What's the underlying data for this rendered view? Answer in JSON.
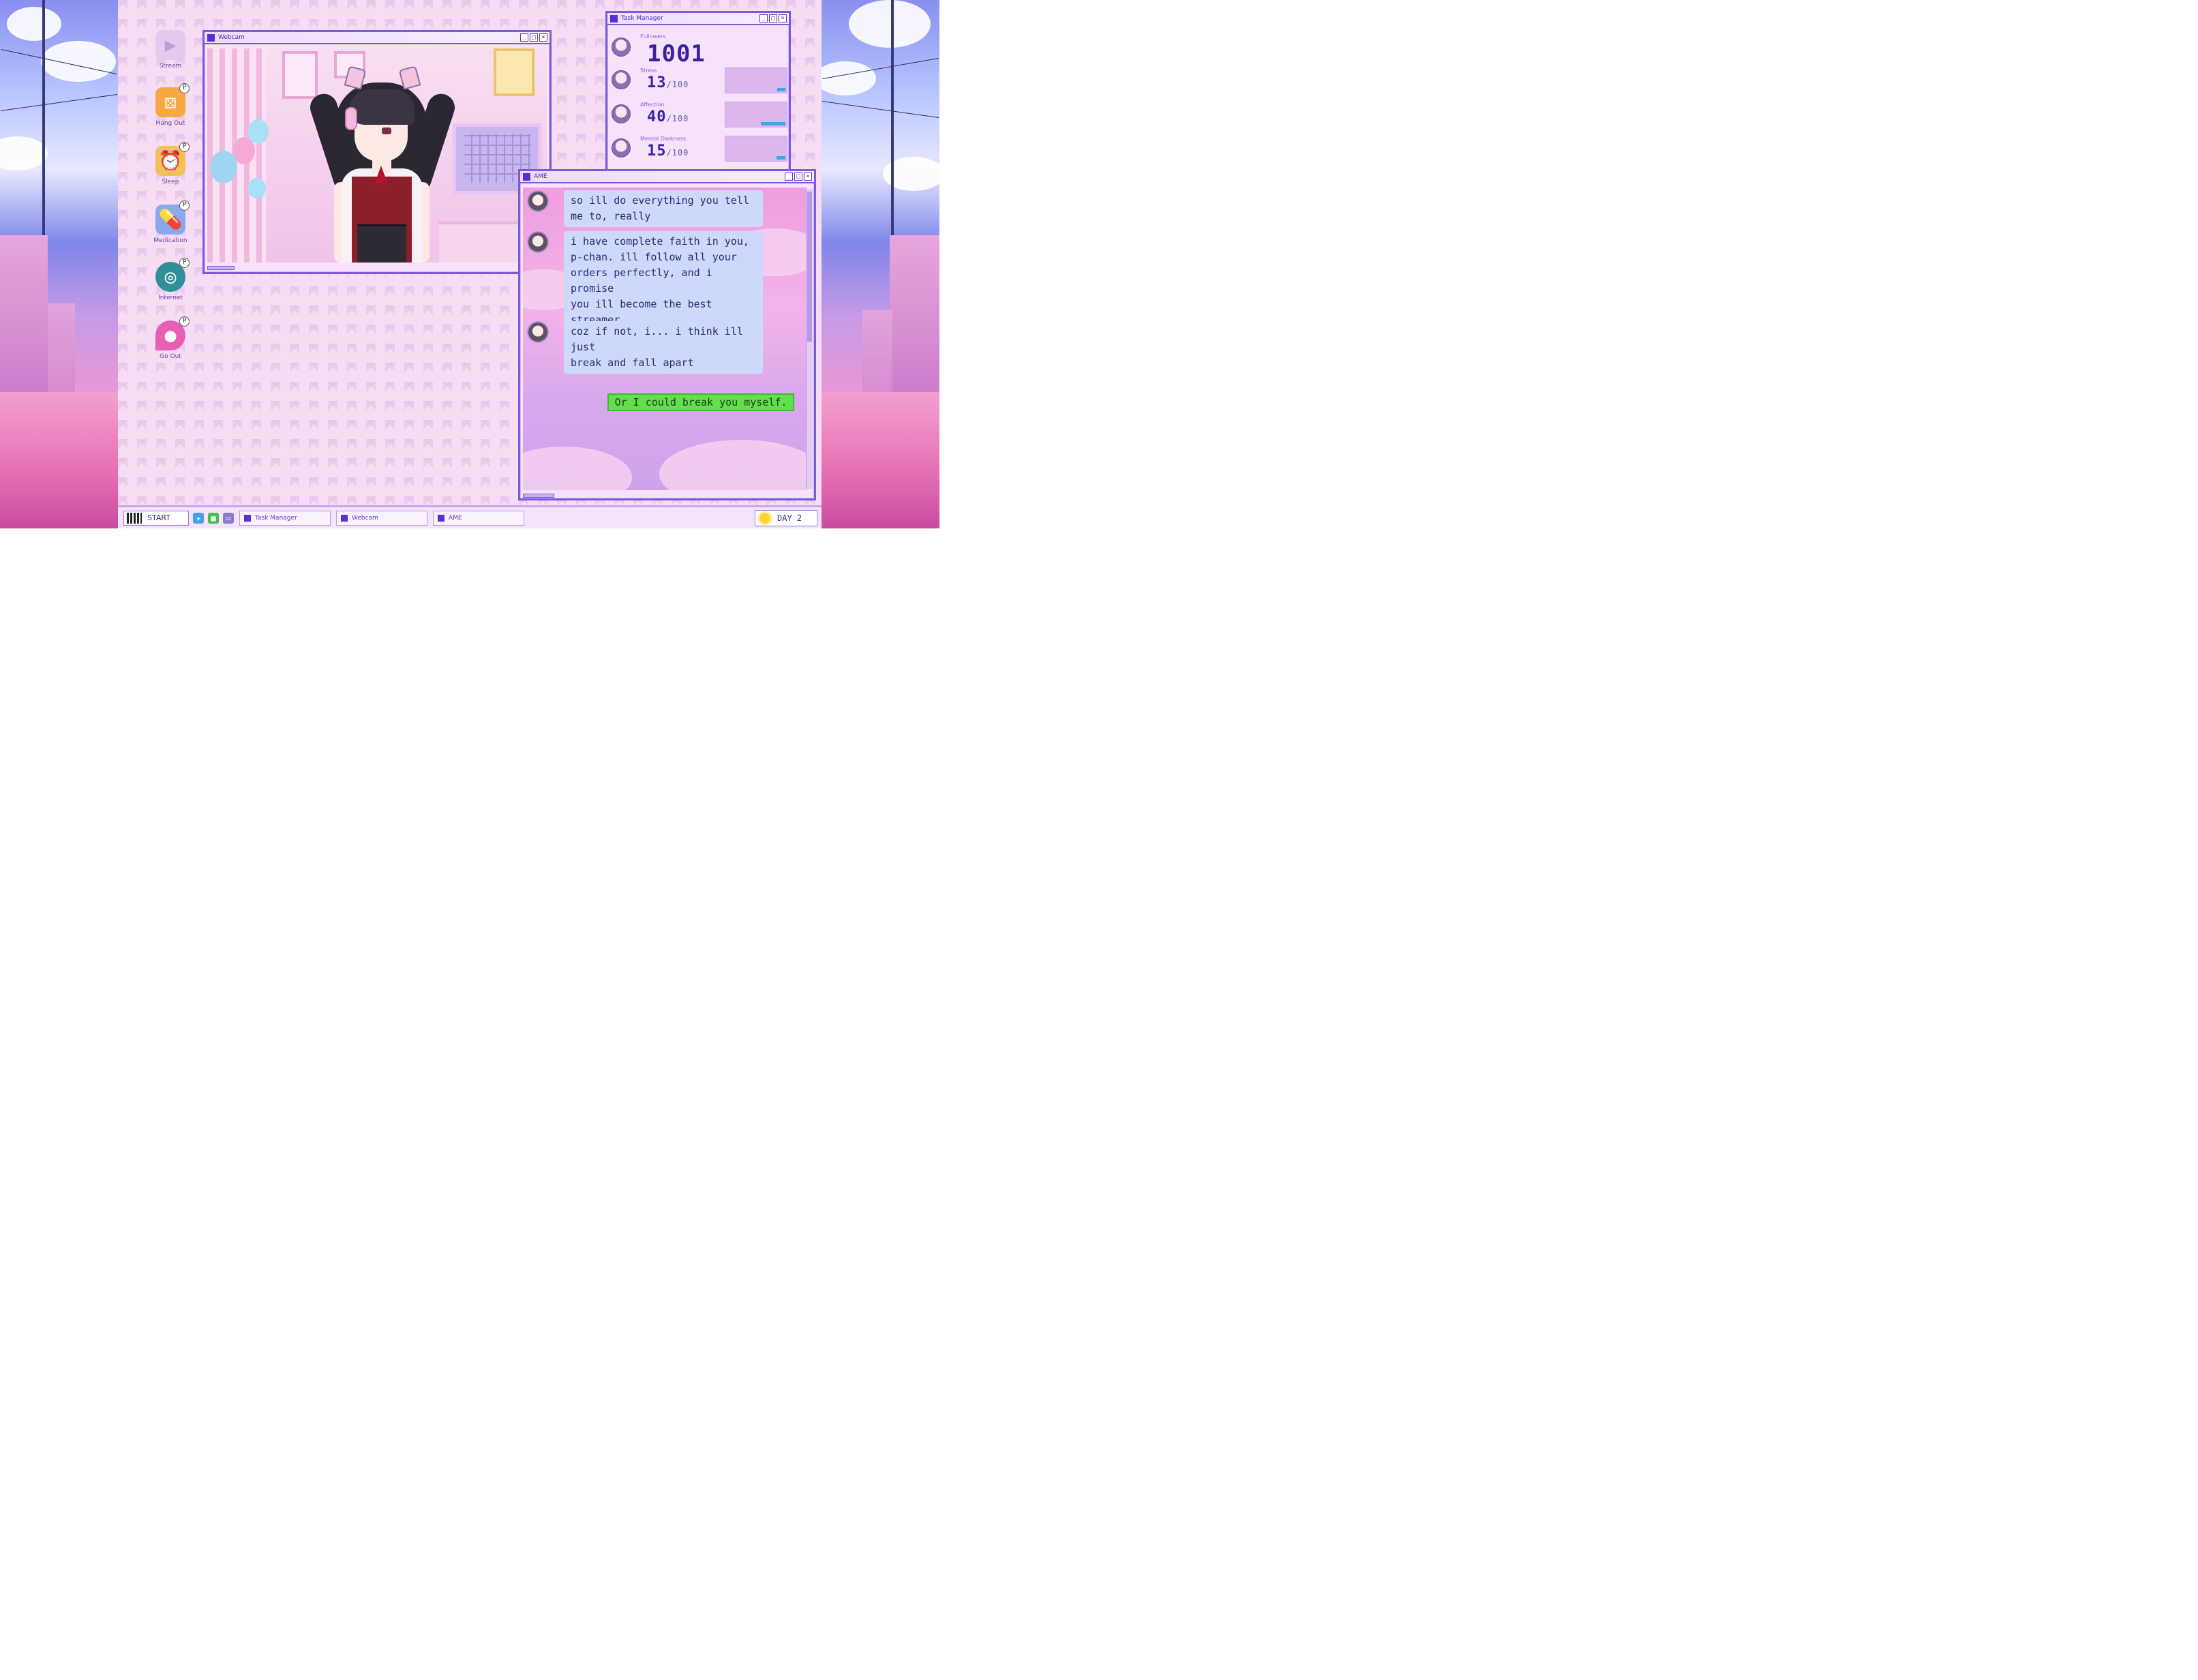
{
  "desktop_icons": [
    {
      "label": "Stream",
      "icon": "play-icon"
    },
    {
      "label": "Hang Out",
      "icon": "dice-icon"
    },
    {
      "label": "Sleep",
      "icon": "alarm-clock-icon"
    },
    {
      "label": "Medication",
      "icon": "pill-icon"
    },
    {
      "label": "Internet",
      "icon": "globe-search-icon"
    },
    {
      "label": "Go Out",
      "icon": "map-pin-icon"
    }
  ],
  "webcam": {
    "title": "Webcam"
  },
  "task_manager": {
    "title": "Task Manager",
    "stats": [
      {
        "label": "Followers",
        "value": "1001",
        "max": ""
      },
      {
        "label": "Stress",
        "value": "13",
        "max": "/100",
        "level": 0.13
      },
      {
        "label": "Affection",
        "value": "40",
        "max": "/100",
        "level": 0.4
      },
      {
        "label": "Mental Darkness",
        "value": "15",
        "max": "/100",
        "level": 0.15
      }
    ]
  },
  "chat": {
    "title": "AME",
    "messages": [
      "so ill do everything you tell\nme to, really",
      "i have complete faith in you,\np-chan. ill follow all your\norders perfectly, and i promise\nyou ill become the best\nstreamer...",
      "coz if not, i... i think ill just\nbreak and fall apart"
    ],
    "reply": "Or I could break you myself."
  },
  "taskbar": {
    "start_label": "START",
    "tasks": [
      "Task Manager",
      "Webcam",
      "AME"
    ],
    "day_label": "DAY 2"
  },
  "colors": {
    "window_border": "#7b5ad8",
    "accent": "#5a2fd0",
    "reply_green": "#62e04a",
    "chat_bubble": "#ccd9fa"
  }
}
